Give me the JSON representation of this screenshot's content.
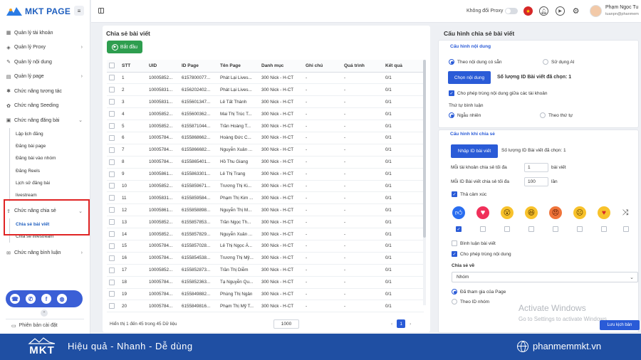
{
  "app": {
    "logo": "MKT PAGE"
  },
  "sidebar": {
    "items": [
      {
        "label": "Quản lý tài khoản",
        "chev": ""
      },
      {
        "label": "Quản lý Proxy",
        "chev": "›"
      },
      {
        "label": "Quản lý nội dung",
        "chev": ""
      },
      {
        "label": "Quản lý page",
        "chev": "›"
      },
      {
        "label": "Chức năng tương tác",
        "chev": ""
      },
      {
        "label": "Chức năng Seeding",
        "chev": ""
      },
      {
        "label": "Chức năng đăng bài",
        "chev": "⌄"
      }
    ],
    "post_sub": [
      "Lập lịch đăng",
      "Đăng bài page",
      "Đăng bài vào nhóm",
      "Đăng Reels",
      "Lịch sử đăng bài",
      "livestream"
    ],
    "share_group": {
      "label": "Chức năng chia sẻ",
      "chev": "⌄"
    },
    "share_sub": [
      "Chia sẻ bài viết",
      "Chia sẻ livestream"
    ],
    "comment_group": {
      "label": "Chức năng bình luận",
      "chev": "›"
    },
    "version": "Phiên bản cài đặt"
  },
  "topbar": {
    "proxy_label": "Không đổi Proxy",
    "user_name": "Phạm Ngọc Tu",
    "user_email": "tuanpn@phanmem"
  },
  "share": {
    "title": "Chia sẻ bài viết",
    "start_label": "Bắt đầu",
    "columns": [
      "STT",
      "UID",
      "ID Page",
      "Tên Page",
      "Danh mục",
      "Ghi chú",
      "Quá trình",
      "Kết quả"
    ],
    "rows": [
      [
        "1",
        "10005852...",
        "6157800077...",
        "Phát Lại Lives...",
        "300 Nick - H-CT",
        "-",
        "-",
        "0/1"
      ],
      [
        "2",
        "10005831...",
        "6156202402...",
        "Phát Lại Lives...",
        "300 Nick - H-CT",
        "-",
        "-",
        "0/1"
      ],
      [
        "3",
        "10005831...",
        "6155601347...",
        "Lê Tất Thành",
        "300 Nick - H-CT",
        "-",
        "-",
        "0/1"
      ],
      [
        "4",
        "10005852...",
        "6155600362...",
        "Mai Thị Trúc T...",
        "300 Nick - H-CT",
        "-",
        "-",
        "0/1"
      ],
      [
        "5",
        "10005852...",
        "6155871044...",
        "Trần Hoàng T...",
        "300 Nick - H-CT",
        "-",
        "-",
        "0/1"
      ],
      [
        "6",
        "10005784...",
        "6155868662...",
        "Hoàng Đức C...",
        "300 Nick - H-CT",
        "-",
        "-",
        "0/1"
      ],
      [
        "7",
        "10005784...",
        "6155866682...",
        "Nguyễn Xuân ...",
        "300 Nick - H-CT",
        "-",
        "-",
        "0/1"
      ],
      [
        "8",
        "10005784...",
        "6155865401...",
        "Hồ Thu Giang",
        "300 Nick - H-CT",
        "-",
        "-",
        "0/1"
      ],
      [
        "9",
        "10005861...",
        "6155863301...",
        "Lê Thị Trang",
        "300 Nick - H-CT",
        "-",
        "-",
        "0/1"
      ],
      [
        "10",
        "10005852...",
        "6155859671...",
        "Trương Thị Ki...",
        "300 Nick - H-CT",
        "-",
        "-",
        "0/1"
      ],
      [
        "11",
        "10005831...",
        "6155859584...",
        "Phạm Thị Kim ...",
        "300 Nick - H-CT",
        "-",
        "-",
        "0/1"
      ],
      [
        "12",
        "10005861...",
        "6155858898...",
        "Nguyễn Thị M...",
        "300 Nick - H-CT",
        "-",
        "-",
        "0/1"
      ],
      [
        "13",
        "10005852...",
        "6155857853...",
        "Trần Ngọc Th...",
        "300 Nick - H-CT",
        "-",
        "-",
        "0/1"
      ],
      [
        "14",
        "10005852...",
        "6155857829...",
        "Nguyễn Xuân ...",
        "300 Nick - H-CT",
        "-",
        "-",
        "0/1"
      ],
      [
        "15",
        "10005784...",
        "6155857028...",
        "Lê Thị Ngọc Á...",
        "300 Nick - H-CT",
        "-",
        "-",
        "0/1"
      ],
      [
        "16",
        "10005784...",
        "6155854538...",
        "Trương Thị Mỹ...",
        "300 Nick - H-CT",
        "-",
        "-",
        "0/1"
      ],
      [
        "17",
        "10005852...",
        "6155852873...",
        "Trần Thị Diễm",
        "300 Nick - H-CT",
        "-",
        "-",
        "0/1"
      ],
      [
        "18",
        "10005784...",
        "6155852363...",
        "Tạ Nguyễn Qu...",
        "300 Nick - H-CT",
        "-",
        "-",
        "0/1"
      ],
      [
        "19",
        "10005784...",
        "6155849882...",
        "Phùng Thị Ngân",
        "300 Nick - H-CT",
        "-",
        "-",
        "0/1"
      ],
      [
        "20",
        "10005784...",
        "6155849816...",
        "Phạm Thị Mỹ T...",
        "300 Nick - H-CT",
        "-",
        "-",
        "0/1"
      ]
    ],
    "footer_info": "Hiển thị 1 đến 45 trong 45 Dữ liệu",
    "page_size": "1000",
    "current_page": "1",
    "prev": "‹",
    "next": "›"
  },
  "config": {
    "title": "Cấu hình chia sẻ bài viết",
    "content_section": "Cấu hình nội dung",
    "opt_available": "Theo nội dung có sẵn",
    "opt_ai": "Sử dụng AI",
    "choose_content_btn": "Chọn nội dung",
    "selected_post_count_1": "Số lượng ID Bài viết đã chọn: 1",
    "allow_dup_accounts": "Cho phép trùng nội dung giữa các tài khoản",
    "comment_order_label": "Thứ tự bình luận",
    "order_random": "Ngẫu nhiên",
    "order_sequential": "Theo thứ tự",
    "share_section": "Cấu hình khi chia sẻ",
    "import_btn": "Nhập ID bài viết",
    "selected_post_count_2": "Số lượng ID Bài viết đã chọn: 1",
    "max_per_account_label": "Mỗi tài khoản chia sẻ tối đa",
    "max_per_account_value": "1",
    "max_per_account_unit": "bài viết",
    "max_per_post_label": "Mỗi ID Bài viết chia sẻ tối đa",
    "max_per_post_value": "100",
    "max_per_post_unit": "lần",
    "react_label": "Thả cảm xúc",
    "comment_label": "Bình luận bài viết",
    "allow_dup_content": "Cho phép trùng nội dung",
    "share_to_label": "Chia sẻ về",
    "share_to_value": "Nhóm",
    "joined_pages": "Đã tham gia của Page",
    "by_group_id": "Theo ID nhóm",
    "save_btn": "Lưu kịch bản"
  },
  "watermark": {
    "line1": "Activate Windows",
    "line2": "Go to Settings to activate Windows."
  },
  "banner": {
    "logo": "MKT",
    "slogan": "Hiệu quả - Nhanh - Dễ dùng",
    "site": "phanmemmkt.vn"
  }
}
